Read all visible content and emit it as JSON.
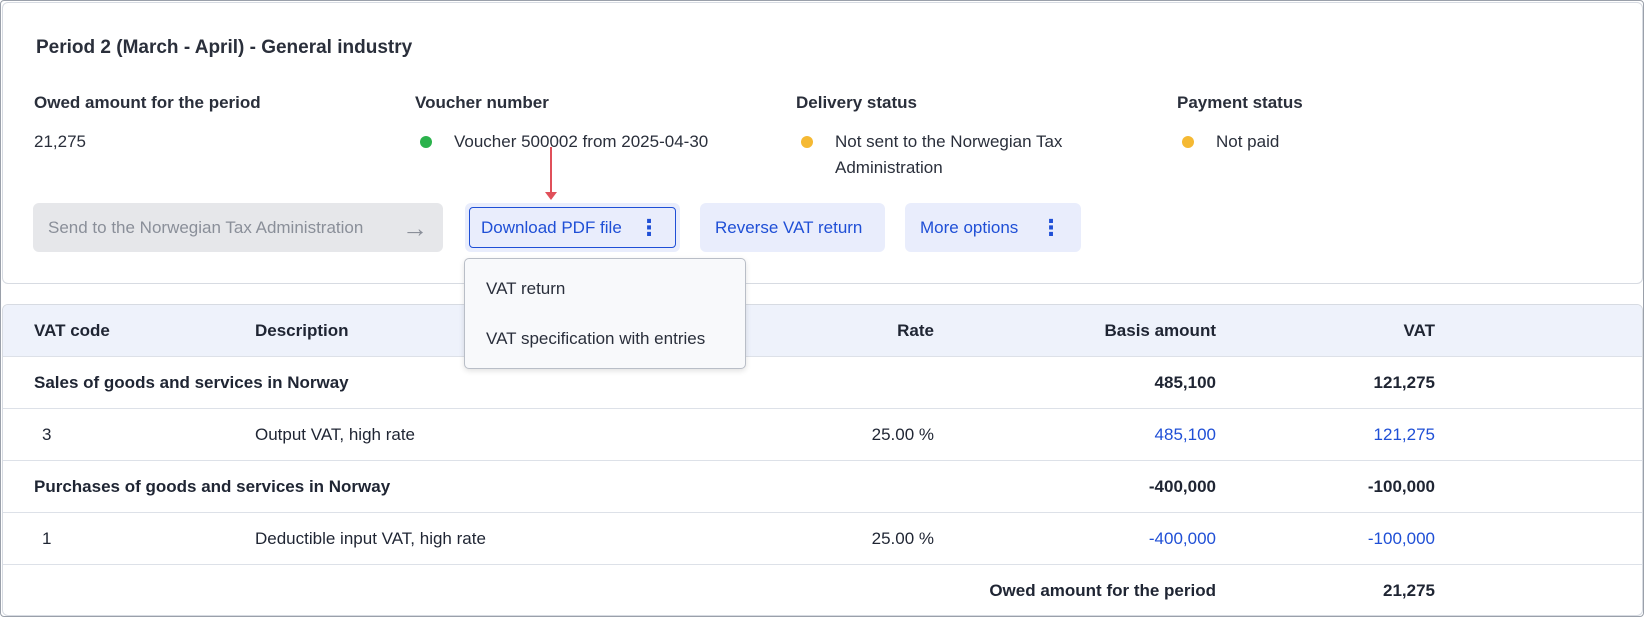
{
  "period_title": "Period 2 (March - April) - General industry",
  "info": {
    "owed": {
      "label": "Owed amount for the period",
      "value": "21,275"
    },
    "voucher": {
      "label": "Voucher number",
      "value": "Voucher 500002 from 2025-04-30",
      "status_color": "#2bb24c"
    },
    "delivery": {
      "label": "Delivery status",
      "value": "Not sent to the Norwegian Tax Administration",
      "status_color": "#f5b933"
    },
    "payment": {
      "label": "Payment status",
      "value": "Not paid",
      "status_color": "#f5b933"
    }
  },
  "actions": {
    "send": "Send to the Norwegian Tax Administration",
    "download_pdf": "Download PDF file",
    "reverse": "Reverse VAT return",
    "more": "More options"
  },
  "pdf_menu": {
    "items": [
      "VAT return",
      "VAT specification with entries"
    ]
  },
  "table": {
    "headers": {
      "code": "VAT code",
      "description": "Description",
      "rate": "Rate",
      "basis": "Basis amount",
      "vat": "VAT"
    },
    "groups": [
      {
        "title": "Sales of goods and services in Norway",
        "basis": "485,100",
        "vat": "121,275"
      },
      {
        "title": "Purchases of goods and services in Norway",
        "basis": "-400,000",
        "vat": "-100,000"
      }
    ],
    "rows": [
      {
        "code": "3",
        "description": "Output VAT, high rate",
        "rate": "25.00 %",
        "basis": "485,100",
        "vat": "121,275"
      },
      {
        "code": "1",
        "description": "Deductible input VAT, high rate",
        "rate": "25.00 %",
        "basis": "-400,000",
        "vat": "-100,000"
      }
    ],
    "total": {
      "label": "Owed amount for the period",
      "vat": "21,275"
    }
  },
  "colors": {
    "accent": "#1f4fd6",
    "pointer": "#e0505a"
  }
}
